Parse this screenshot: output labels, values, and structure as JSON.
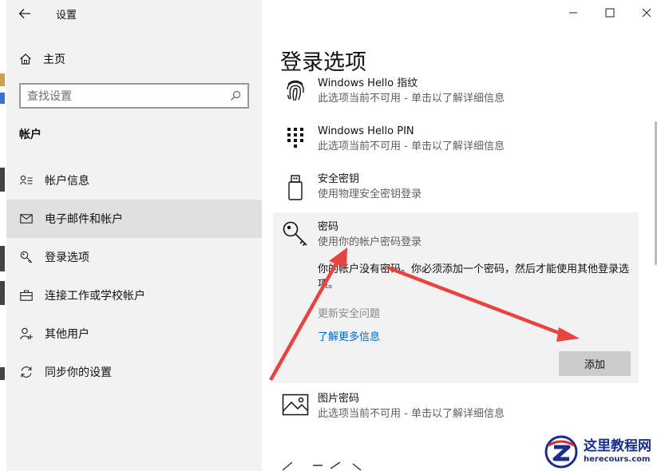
{
  "window": {
    "title": "设置"
  },
  "sidebar": {
    "home_label": "主页",
    "search_placeholder": "查找设置",
    "section_title": "帐户",
    "items": [
      {
        "label": "帐户信息",
        "icon": "account-info-icon"
      },
      {
        "label": "电子邮件和帐户",
        "icon": "mail-icon",
        "selected": true
      },
      {
        "label": "登录选项",
        "icon": "key-icon"
      },
      {
        "label": "连接工作或学校帐户",
        "icon": "briefcase-icon"
      },
      {
        "label": "其他用户",
        "icon": "add-user-icon"
      },
      {
        "label": "同步你的设置",
        "icon": "sync-icon"
      }
    ]
  },
  "main": {
    "title": "登录选项",
    "options": [
      {
        "title": "Windows Hello 指纹",
        "subtitle": "此选项当前不可用 - 单击以了解详细信息",
        "icon": "fingerprint-icon"
      },
      {
        "title": "Windows Hello PIN",
        "subtitle": "此选项当前不可用 - 单击以了解详细信息",
        "icon": "pin-keypad-icon"
      },
      {
        "title": "安全密钥",
        "subtitle": "使用物理安全密钥登录",
        "icon": "usb-key-icon"
      },
      {
        "title": "图片密码",
        "subtitle": "此选项当前不可用 - 单击以了解详细信息",
        "icon": "picture-icon"
      }
    ],
    "password": {
      "title": "密码",
      "subtitle": "使用你的帐户密码登录",
      "icon": "key-icon",
      "description": "你的帐户没有密码。你必须添加一个密码，然后才能使用其他登录选项。",
      "update_link": "更新安全问题",
      "learn_more_link": "了解更多信息",
      "add_button": "添加"
    }
  },
  "watermark": {
    "title": "这里教程网",
    "url": "herecours.com"
  },
  "colors": {
    "accent": "#0067c0",
    "annotation_arrow": "#e8433f",
    "sidebar_bg": "#f2f2f2",
    "selected_bg": "#e0e0e0"
  }
}
